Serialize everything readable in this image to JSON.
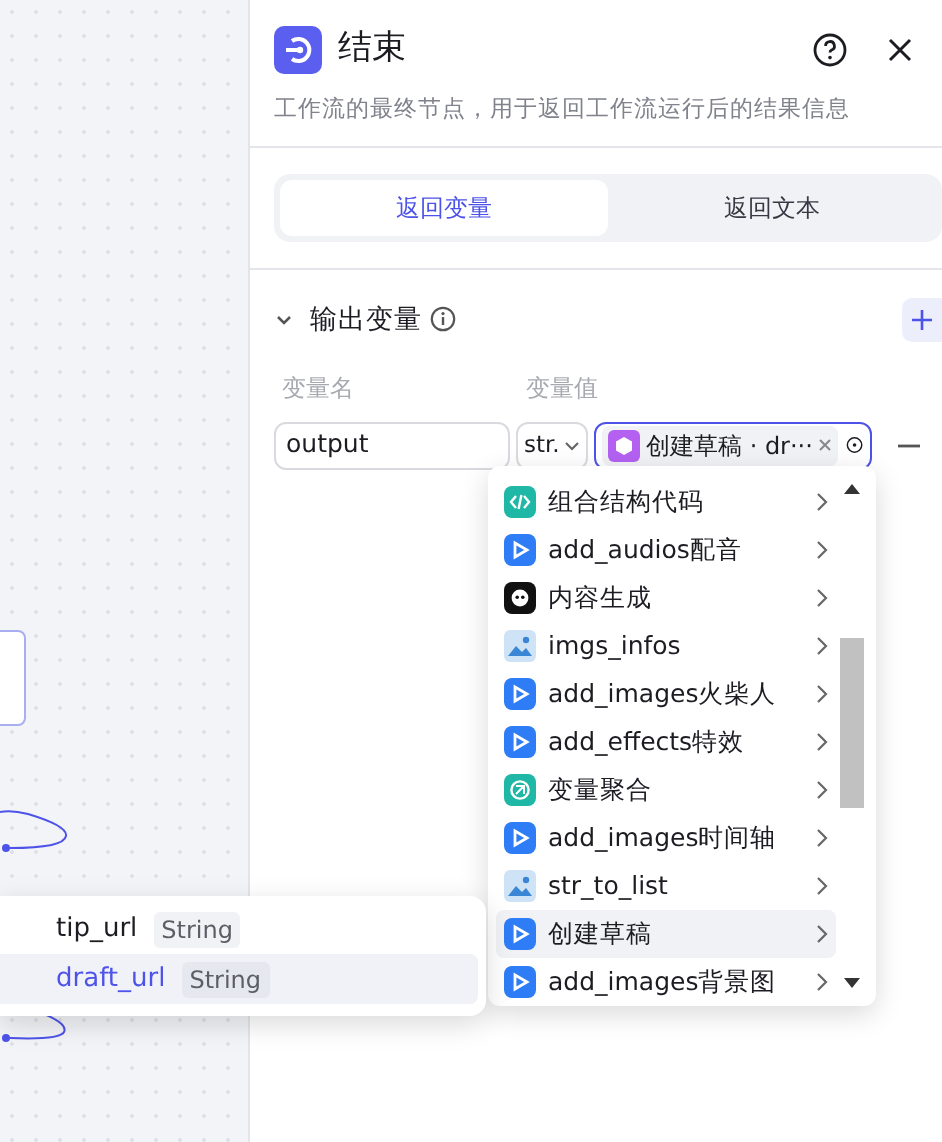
{
  "panel": {
    "title": "结束",
    "description": "工作流的最终节点，用于返回工作流运行后的结果信息",
    "tabs": [
      {
        "label": "返回变量",
        "selected": true
      },
      {
        "label": "返回文本",
        "selected": false
      }
    ],
    "section": {
      "title": "输出变量",
      "expanded": true,
      "columns": [
        "变量名",
        "变量值"
      ],
      "rows": [
        {
          "name": "output",
          "type": "str.",
          "reference": "创建草稿 · dr···"
        }
      ]
    }
  },
  "reference_menu": {
    "items": [
      {
        "label": "组合结构代码",
        "kind": "code",
        "selected": false
      },
      {
        "label": "add_audios配音",
        "kind": "plugin",
        "selected": false
      },
      {
        "label": "内容生成",
        "kind": "bot",
        "selected": false
      },
      {
        "label": "imgs_infos",
        "kind": "image",
        "selected": false
      },
      {
        "label": "add_images火柴人",
        "kind": "plugin",
        "selected": false
      },
      {
        "label": "add_effects特效",
        "kind": "plugin",
        "selected": false
      },
      {
        "label": "变量聚合",
        "kind": "aggregate",
        "selected": false
      },
      {
        "label": "add_images时间轴",
        "kind": "plugin",
        "selected": false
      },
      {
        "label": "str_to_list",
        "kind": "image",
        "selected": false
      },
      {
        "label": "创建草稿",
        "kind": "plugin",
        "selected": true
      },
      {
        "label": "add_images背景图",
        "kind": "plugin",
        "selected": false
      }
    ]
  },
  "output_submenu": {
    "items": [
      {
        "name": "tip_url",
        "type": "String",
        "selected": false
      },
      {
        "name": "draft_url",
        "type": "String",
        "selected": true
      }
    ]
  }
}
